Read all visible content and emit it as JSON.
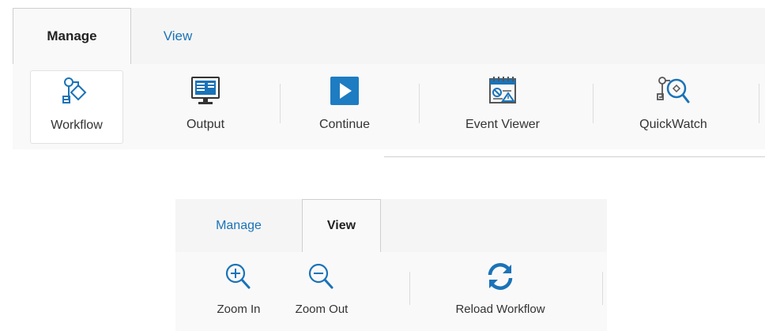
{
  "ribbon_top": {
    "tabs": [
      {
        "label": "Manage",
        "active": true
      },
      {
        "label": "View",
        "active": false
      }
    ],
    "buttons": [
      {
        "label": "Workflow",
        "icon": "workflow-icon",
        "selected": true
      },
      {
        "label": "Output",
        "icon": "output-monitor-icon",
        "selected": false
      },
      {
        "label": "Continue",
        "icon": "play-icon",
        "selected": false
      },
      {
        "label": "Event Viewer",
        "icon": "event-viewer-icon",
        "selected": false
      },
      {
        "label": "QuickWatch",
        "icon": "quickwatch-icon",
        "selected": false
      }
    ]
  },
  "ribbon_bottom": {
    "tabs": [
      {
        "label": "Manage",
        "active": false
      },
      {
        "label": "View",
        "active": true
      }
    ],
    "buttons": [
      {
        "label": "Zoom In",
        "icon": "zoom-in-icon"
      },
      {
        "label": "Zoom Out",
        "icon": "zoom-out-icon"
      },
      {
        "label": "Reload Workflow",
        "icon": "reload-icon"
      }
    ]
  },
  "colors": {
    "accent": "#1a73b8",
    "play_button": "#1e7cc2",
    "tab_strip": "#f5f5f5",
    "toolbar": "#f9f9f9"
  }
}
